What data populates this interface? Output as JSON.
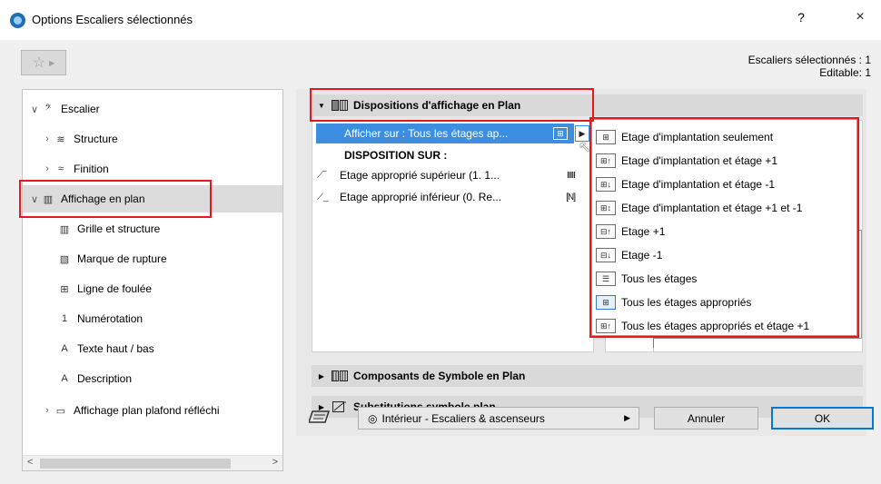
{
  "window": {
    "title": "Options Escaliers sélectionnés",
    "help_label": "?",
    "close_label": "×"
  },
  "favorites": {
    "star": "☆",
    "arrow": "▶"
  },
  "selection_info": {
    "selected": "Escaliers sélectionnés : 1",
    "editable": "Editable: 1"
  },
  "tree": {
    "items": [
      {
        "label": "Escalier",
        "chevron": "∨",
        "icon": "stair-icon",
        "glyph": "𝄢"
      },
      {
        "label": "Structure",
        "chevron": "›",
        "icon": "structure-icon",
        "glyph": "≋"
      },
      {
        "label": "Finition",
        "chevron": "›",
        "icon": "finish-icon",
        "glyph": "≈"
      },
      {
        "label": "Affichage en plan",
        "chevron": "∨",
        "icon": "plan-display-icon",
        "glyph": "▥"
      },
      {
        "label": "Grille et structure",
        "chevron": "",
        "icon": "grid-icon",
        "glyph": "▥"
      },
      {
        "label": "Marque de rupture",
        "chevron": "",
        "icon": "break-mark-icon",
        "glyph": "▧"
      },
      {
        "label": "Ligne de foulée",
        "chevron": "",
        "icon": "walking-line-icon",
        "glyph": "⊞"
      },
      {
        "label": "Numérotation",
        "chevron": "",
        "icon": "numbering-icon",
        "glyph": "1"
      },
      {
        "label": "Texte haut / bas",
        "chevron": "",
        "icon": "text-icon",
        "glyph": "A"
      },
      {
        "label": "Description",
        "chevron": "",
        "icon": "description-icon",
        "glyph": "A"
      },
      {
        "label": "Affichage plan plafond réfléchi",
        "chevron": "›",
        "icon": "ceiling-plan-icon",
        "glyph": "▭"
      }
    ],
    "scroll_left": "<",
    "scroll_right": ">"
  },
  "sections": {
    "plan_display": {
      "title": "Dispositions d'affichage en Plan",
      "expanded": "▼"
    },
    "symbol_components": {
      "title": "Composants de Symbole en Plan",
      "expanded": "▶"
    },
    "symbol_substitution": {
      "title": "Substitutions symbole plan",
      "expanded": "▶"
    }
  },
  "display_list": {
    "selected_row": "Afficher sur : Tous les étages ap...",
    "arrow": "▶",
    "disposition_header": "DISPOSITION SUR :",
    "rows": [
      {
        "label": "Etage approprié supérieur (1. 1...",
        "lead": "⟋‾",
        "icon": "IIIII"
      },
      {
        "label": "Etage approprié inférieur (0. Re...",
        "lead": "⟋_",
        "icon": "[N]"
      }
    ]
  },
  "dropdown": {
    "items": [
      "Etage d'implantation seulement",
      "Etage d'implantation et étage +1",
      "Etage d'implantation et étage -1",
      "Etage d'implantation et étage +1 et -1",
      "Etage +1",
      "Etage -1",
      "Tous les étages",
      "Tous les étages appropriés",
      "Tous les étages appropriés et étage +1"
    ],
    "current_index": 7
  },
  "bottom": {
    "view_name": "Intérieur - Escaliers & ascenseurs",
    "cancel": "Annuler",
    "ok": "OK"
  },
  "colors": {
    "highlight": "#3b8ee2",
    "callout": "#e5191c"
  }
}
